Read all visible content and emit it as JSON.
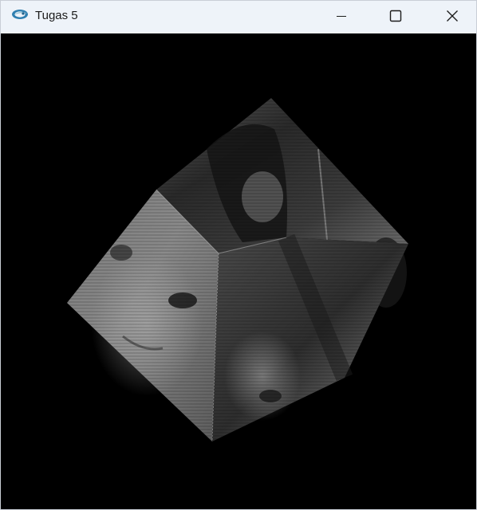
{
  "window": {
    "title": "Tugas 5",
    "app_icon": "opengl-app-icon",
    "buttons": {
      "minimize_icon": "minimize-icon",
      "maximize_icon": "maximize-icon",
      "close_icon": "close-icon"
    }
  },
  "canvas": {
    "background": "#000000",
    "object": "textured-rotating-cube",
    "visible_faces": [
      "top-face",
      "left-face",
      "right-face"
    ]
  },
  "colors": {
    "titlebar": "#eef3f9",
    "title_text": "#1b1b1b",
    "close_hover": "#e81123"
  }
}
